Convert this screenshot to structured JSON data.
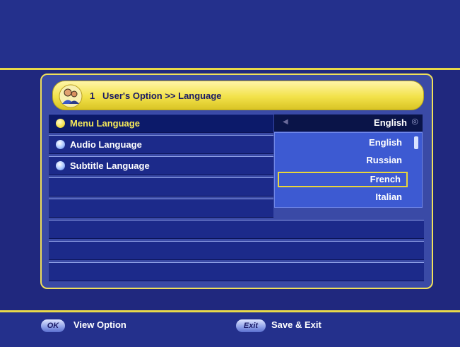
{
  "title": {
    "number": "1",
    "breadcrumb": "User's Option >> Language",
    "icon": "users-icon"
  },
  "rows": [
    {
      "label": "Menu Language",
      "bullet": "yellow",
      "active": true
    },
    {
      "label": "Audio Language",
      "bullet": "blue",
      "active": false
    },
    {
      "label": "Subtitle Language",
      "bullet": "blue",
      "active": false
    }
  ],
  "current_value": "English",
  "dropdown": {
    "options": [
      "English",
      "Russian",
      "French",
      "Italian"
    ],
    "highlighted": "French"
  },
  "footer": {
    "ok_key": "OK",
    "ok_label": "View Option",
    "exit_key": "Exit",
    "exit_label": "Save & Exit"
  },
  "colors": {
    "background": "#24308c",
    "accent_yellow": "#f0e05a",
    "highlight_row": "#0c1a6a"
  }
}
